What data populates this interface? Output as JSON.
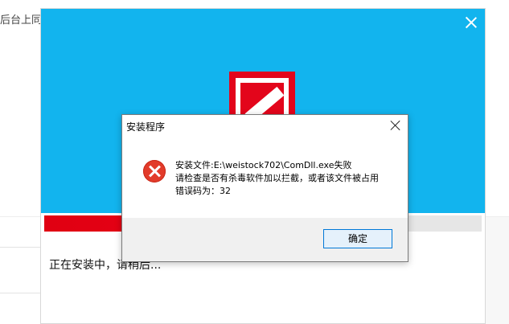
{
  "background_window": {
    "title_fragment": "后台上同步"
  },
  "installer": {
    "progress_percent": 82,
    "status_text": "正在安装中，请稍后..."
  },
  "dialog": {
    "title": "安装程序",
    "messages": [
      "安装文件:E:\\weistock702\\ComDll.exe失败",
      "请检查是否有杀毒软件加以拦截，或者该文件被占用",
      "错误码为：32"
    ],
    "ok_label": "确定"
  },
  "colors": {
    "banner": "#12b4ee",
    "logo_red": "#e3051b",
    "progress_red": "#e00012",
    "error_red": "#e23b2a",
    "button_border": "#0078d7"
  },
  "icons": {
    "installer_close": "close-icon",
    "dialog_close": "close-icon",
    "error": "error-icon"
  }
}
